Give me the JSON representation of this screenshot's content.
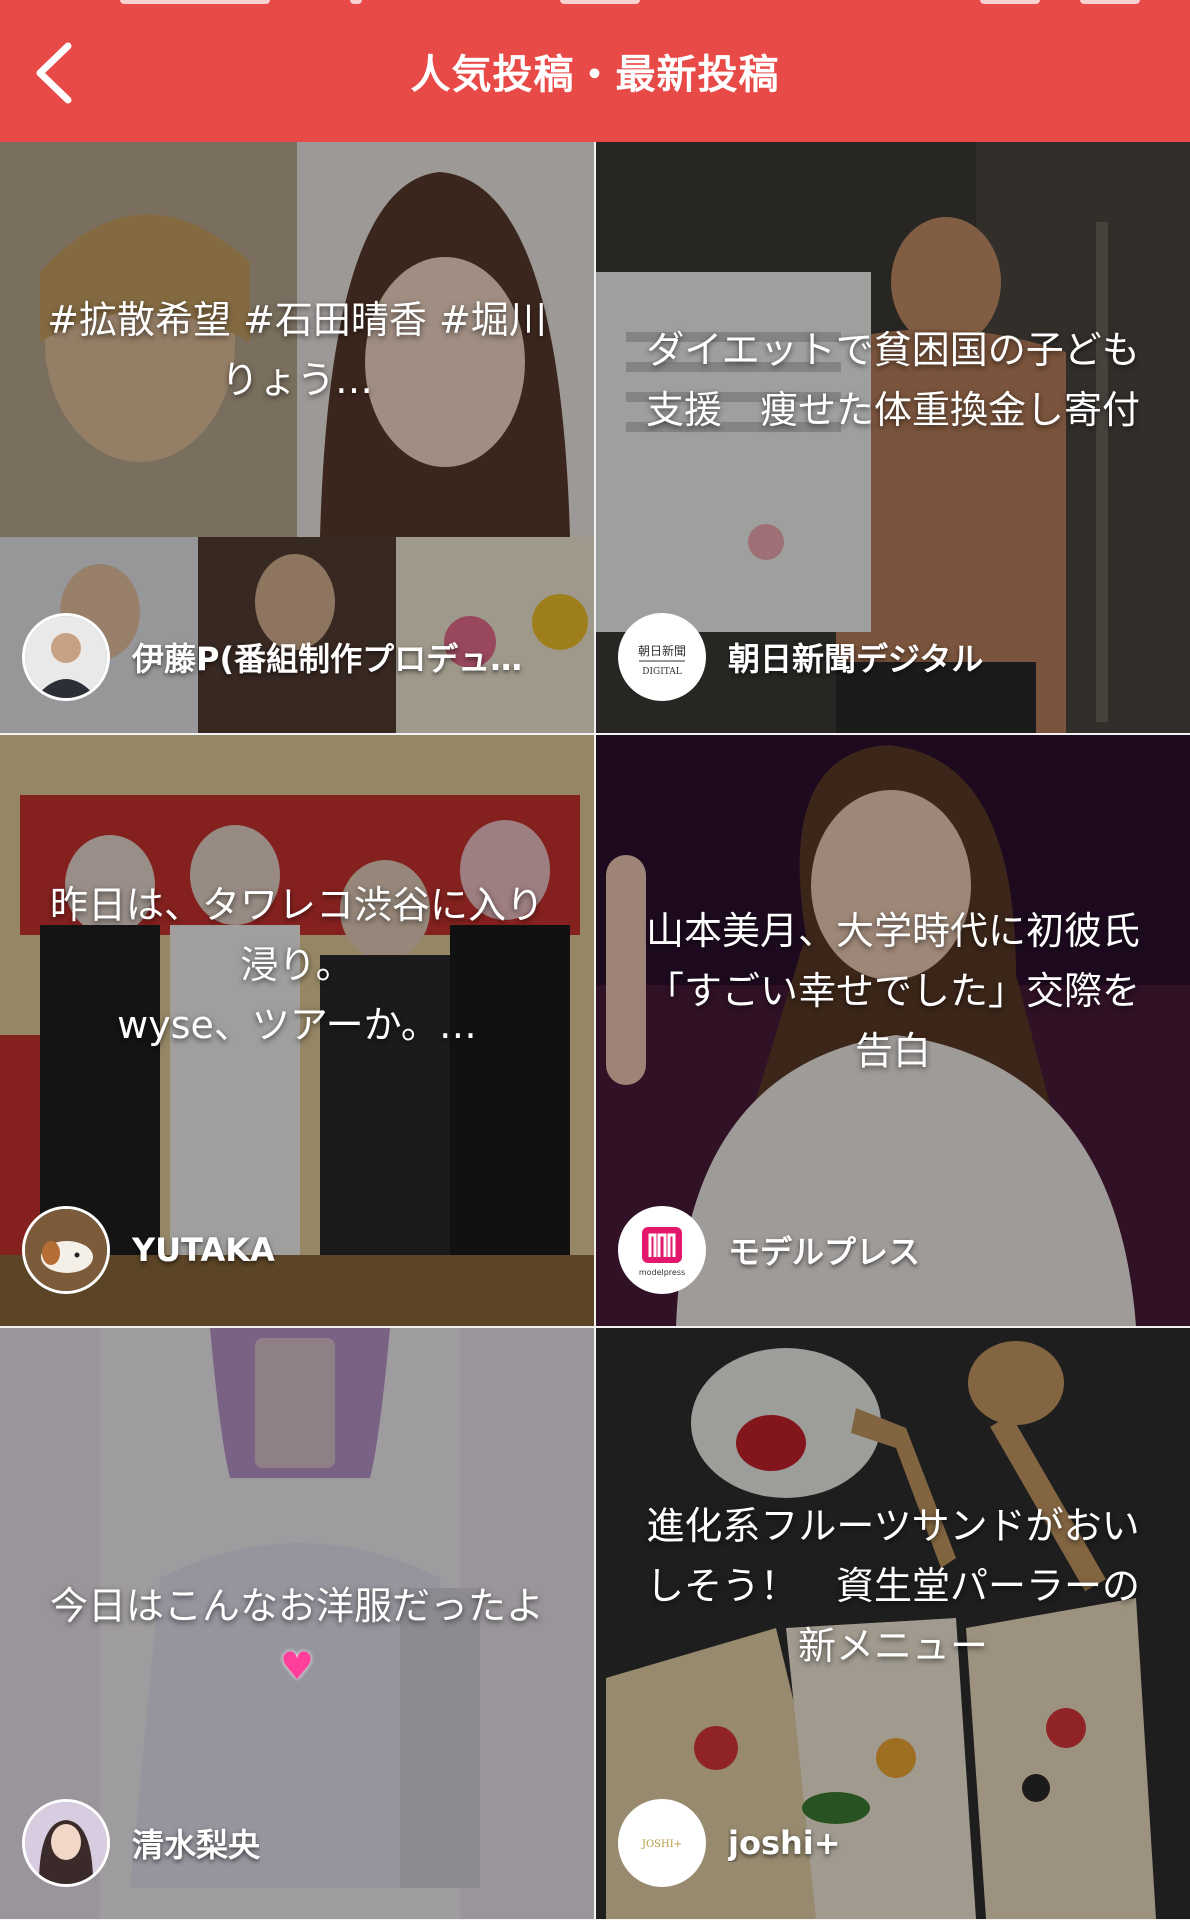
{
  "header": {
    "title": "人気投稿・最新投稿",
    "background_color": "#e84a48"
  },
  "posts": [
    {
      "headline": "#拡散希望 #石田晴香 #堀川りょう…",
      "author": "伊藤P(番組制作プロデューサー)",
      "avatar_icon": "person-photo-icon"
    },
    {
      "headline": "ダイエットで貧困国の子ども支援　痩せた体重換金し寄付",
      "author": "朝日新聞デジタル",
      "avatar_icon": "asahi-logo-icon",
      "avatar_text_top": "朝日新聞",
      "avatar_text_bottom": "DIGITAL"
    },
    {
      "headline": "昨日は、タワレコ渋谷に入り浸り。\nwyse、ツアーか。…",
      "author": "YUTAKA",
      "avatar_icon": "dog-photo-icon"
    },
    {
      "headline": "山本美月、大学時代に初彼氏「すごい幸せでした」交際を告白",
      "author": "モデルプレス",
      "avatar_icon": "modelpress-logo-icon",
      "avatar_text": "modelpress"
    },
    {
      "headline": "今日はこんなお洋服だったよ",
      "author": "清水梨央",
      "avatar_icon": "person-photo-icon"
    },
    {
      "headline": "進化系フルーツサンドがおいしそう！　資生堂パーラーの新メニュー",
      "author": "joshi+",
      "avatar_icon": "joshi-logo-icon",
      "avatar_text": "JOSHI+"
    }
  ]
}
